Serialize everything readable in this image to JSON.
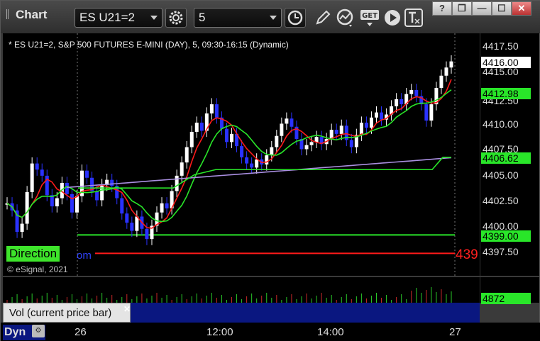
{
  "toolbar": {
    "title": "Chart",
    "symbol": "ES U21=2",
    "interval": "5",
    "get_label": "GET"
  },
  "window_buttons": {
    "help": "?",
    "restore": "❐",
    "minimize": "—",
    "maximize": "☐",
    "close": "✕"
  },
  "chart": {
    "header": "* ES U21=2, S&P 500 FUTURES E-MINI (DAY), 5, 09:30-16:15 (Dynamic)",
    "copyright": "© eSignal, 2021",
    "direction_label": "Direction",
    "overlap_text": "om",
    "red_tag": "439",
    "y_ticks": [
      "4417.50",
      "4415.00",
      "4412.50",
      "4410.00",
      "4407.50",
      "4405.00",
      "4402.50",
      "4400.00",
      "4397.50"
    ],
    "price_tags": {
      "last": "4416.00",
      "ma_fast": "4412.98",
      "ma_slow": "4406.62",
      "level": "4399.00"
    },
    "colors": {
      "up_candle": "#ffffff",
      "down_candle": "#2a32ff",
      "ma_red": "#ff1a1a",
      "ma_green": "#29e629",
      "ma_purple": "#a98ee0",
      "level_green": "#29e629",
      "level_red": "#ff1a1a"
    }
  },
  "volume": {
    "label": "Vol (current price bar)",
    "value": "4872",
    "close_label": "✕"
  },
  "time_axis": {
    "mode_label": "Dyn",
    "labels": [
      "26",
      "12:00",
      "14:00",
      "27"
    ]
  }
}
